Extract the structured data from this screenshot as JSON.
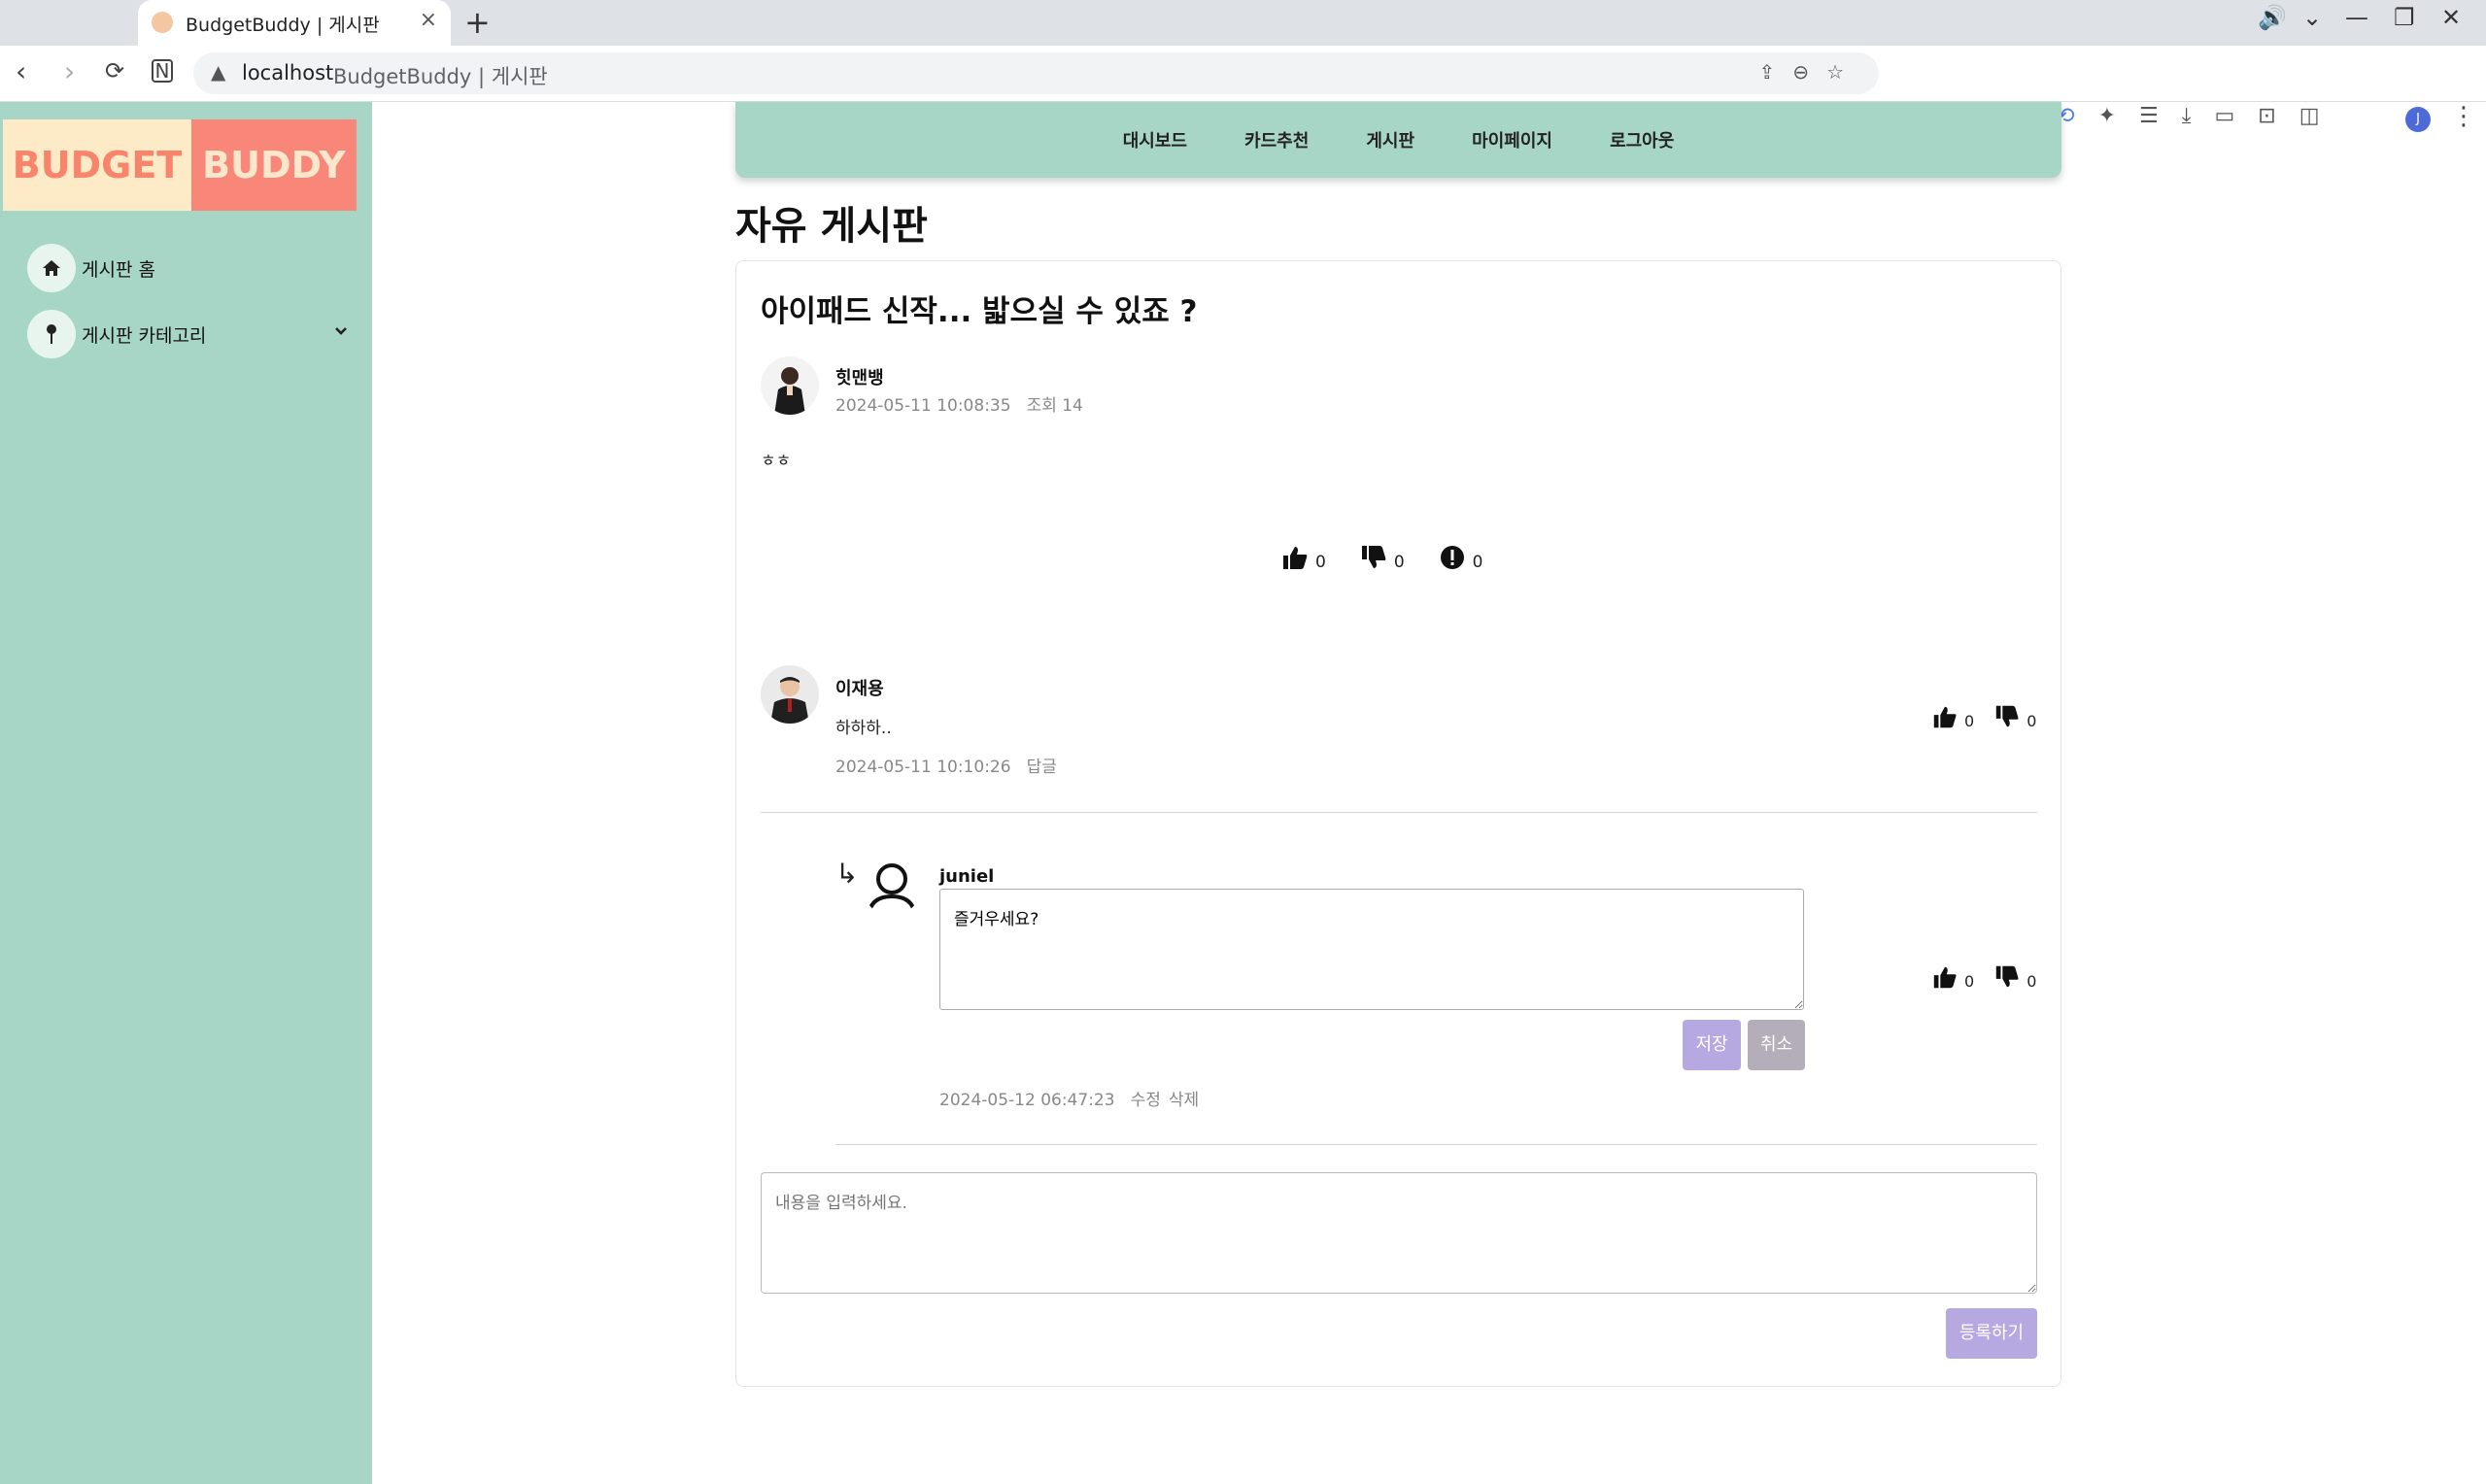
{
  "browser": {
    "tab_title": "BudgetBuddy | 게시판",
    "url_host": "localhost",
    "url_title": "BudgetBuddy | 게시판"
  },
  "logo": {
    "left": "BUDGET",
    "right": "BUDDY"
  },
  "sidebar": {
    "items": [
      {
        "label": "게시판 홈",
        "icon": "home-icon"
      },
      {
        "label": "게시판 카테고리",
        "icon": "pin-icon"
      }
    ]
  },
  "topnav": {
    "items": [
      "대시보드",
      "카드추천",
      "게시판",
      "마이페이지",
      "로그아웃"
    ]
  },
  "page_title": "자유 게시판",
  "post": {
    "title": "아이패드 신작... 밟으실 수 있죠 ?",
    "author": "힛맨뱅",
    "date": "2024-05-11 10:08:35",
    "views": "조회 14",
    "body": "ㅎㅎ",
    "likes": "0",
    "dislikes": "0",
    "reports": "0"
  },
  "comments": [
    {
      "author": "이재용",
      "text": "하하하..",
      "date": "2024-05-11 10:10:26",
      "reply_label": "답글",
      "likes": "0",
      "dislikes": "0"
    }
  ],
  "reply": {
    "author": "juniel",
    "edit_value": "즐거우세요?",
    "save_label": "저장",
    "cancel_label": "취소",
    "date": "2024-05-12 06:47:23",
    "edit_label": "수정",
    "delete_label": "삭제",
    "likes": "0",
    "dislikes": "0"
  },
  "new_comment": {
    "placeholder": "내용을 입력하세요.",
    "submit_label": "등록하기"
  },
  "colors": {
    "mint": "#a8d6c6",
    "logo_cream": "#fdebc8",
    "logo_salmon": "#f8877a",
    "button_lavender": "#b6a9e2",
    "button_gray": "#b3aeb9"
  }
}
